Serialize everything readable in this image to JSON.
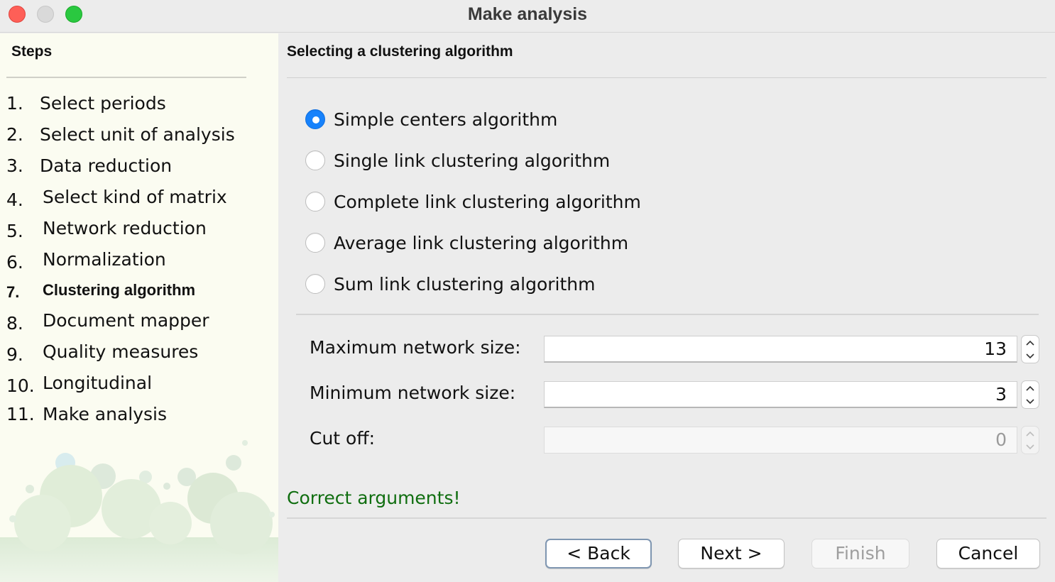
{
  "window": {
    "title": "Make analysis"
  },
  "steps": {
    "title": "Steps",
    "items": [
      {
        "num": "1.",
        "label": "Select periods",
        "active": false
      },
      {
        "num": "2.",
        "label": "Select unit of analysis",
        "active": false
      },
      {
        "num": "3.",
        "label": "Data reduction",
        "active": false
      },
      {
        "num": "4.",
        "label": "Select kind of matrix",
        "active": false
      },
      {
        "num": "5.",
        "label": "Network reduction",
        "active": false
      },
      {
        "num": "6.",
        "label": "Normalization",
        "active": false
      },
      {
        "num": "7.",
        "label": "Clustering algorithm",
        "active": true
      },
      {
        "num": "8.",
        "label": "Document mapper",
        "active": false
      },
      {
        "num": "9.",
        "label": "Quality measures",
        "active": false
      },
      {
        "num": "10.",
        "label": "Longitudinal",
        "active": false
      },
      {
        "num": "11.",
        "label": "Make analysis",
        "active": false
      }
    ]
  },
  "main": {
    "title": "Selecting a clustering algorithm",
    "algorithms": [
      {
        "label": "Simple centers algorithm",
        "selected": true
      },
      {
        "label": "Single link clustering algorithm",
        "selected": false
      },
      {
        "label": "Complete link clustering algorithm",
        "selected": false
      },
      {
        "label": "Average link clustering algorithm",
        "selected": false
      },
      {
        "label": "Sum link clustering algorithm",
        "selected": false
      }
    ],
    "fields": {
      "max_network_size": {
        "label": "Maximum network size:",
        "value": "13",
        "enabled": true
      },
      "min_network_size": {
        "label": "Minimum network size:",
        "value": "3",
        "enabled": true
      },
      "cut_off": {
        "label": "Cut off:",
        "value": "0",
        "enabled": false
      }
    },
    "status": "Correct arguments!",
    "buttons": {
      "back": "< Back",
      "next": "Next >",
      "finish": "Finish",
      "cancel": "Cancel"
    }
  },
  "colors": {
    "radio_selected": "#1782fb",
    "status_text": "#106e10",
    "sidebar_bg": "#fbfcf1"
  }
}
